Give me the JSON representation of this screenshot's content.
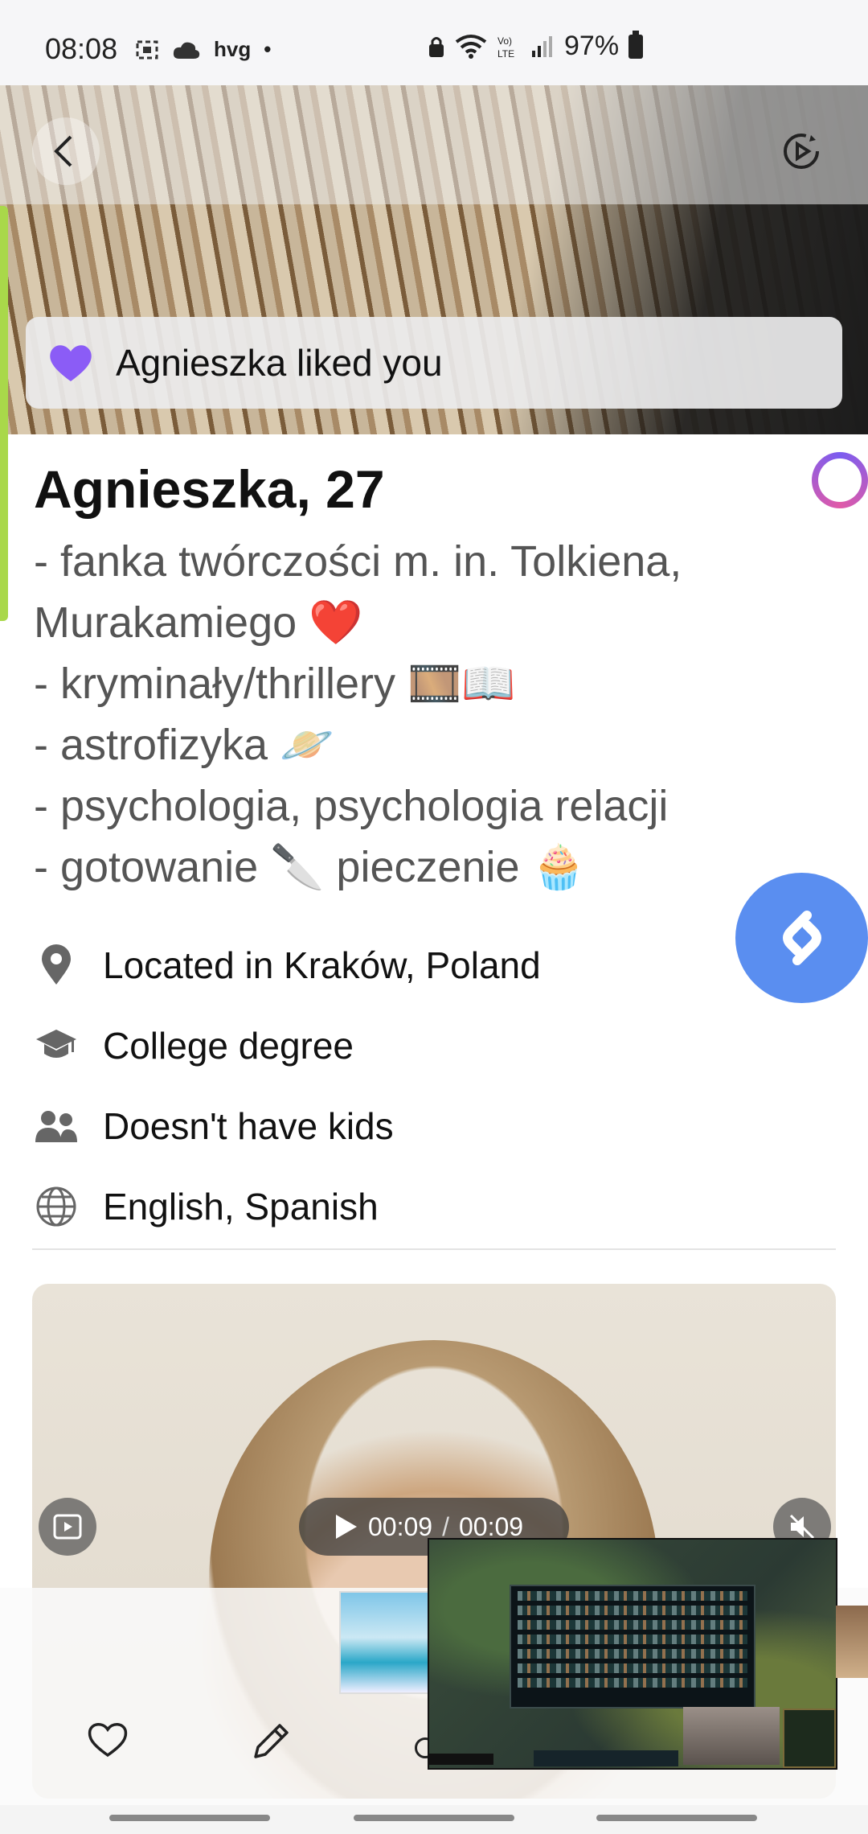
{
  "status_bar": {
    "time": "08:08",
    "carrier": "hvg",
    "battery": "97%",
    "icons_left": [
      "screenshot-icon",
      "cloud-icon"
    ],
    "icons_right": [
      "vpn-lock-icon",
      "wifi-icon",
      "volte-icon",
      "signal-icon",
      "battery-icon"
    ]
  },
  "header": {
    "back_icon": "back-arrow-icon",
    "replay_icon": "replay-video-icon"
  },
  "banner": {
    "text": "Agnieszka liked you",
    "heart_color": "#8b5cf6"
  },
  "profile": {
    "name_age": "Agnieszka, 27",
    "bio_lines": [
      "- fanka twórczości m. in. Tolkiena,",
      "Murakamiego ❤️",
      "- kryminały/thrillery 🎞️📖",
      "- astrofizyka 🪐",
      "- psychologia, psychologia  relacji",
      "- gotowanie 🔪 pieczenie 🧁"
    ],
    "facts": [
      {
        "icon": "location-pin-icon",
        "text": "Located in Kraków, Poland"
      },
      {
        "icon": "graduation-cap-icon",
        "text": "College degree"
      },
      {
        "icon": "people-icon",
        "text": "Doesn't have kids"
      },
      {
        "icon": "globe-icon",
        "text": "English, Spanish"
      }
    ]
  },
  "video": {
    "current_time": "00:09",
    "separator": "/",
    "duration": "00:09"
  },
  "accent_colors": {
    "shazam": "#5a8ef0",
    "green_edge": "#a9d84a"
  }
}
